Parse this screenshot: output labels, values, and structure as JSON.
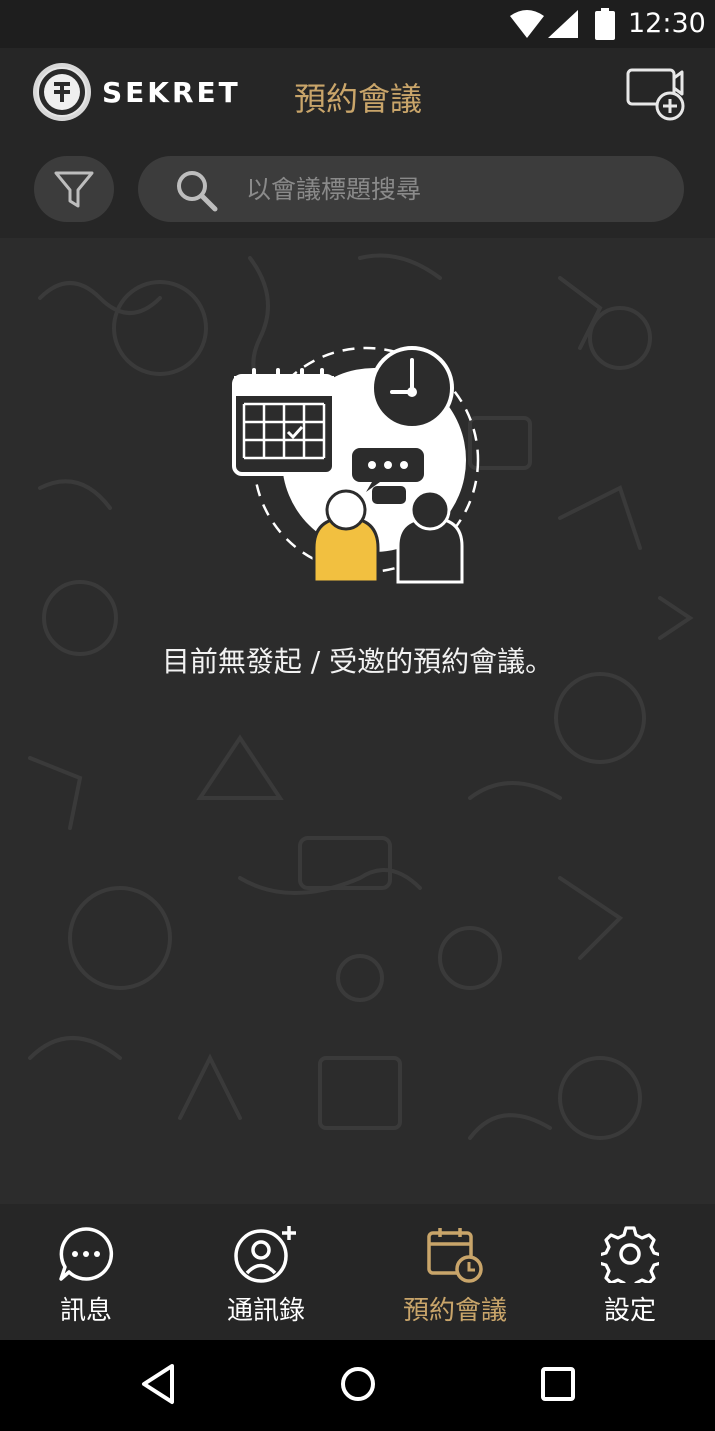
{
  "status_bar": {
    "time": "12:30"
  },
  "app_bar": {
    "brand": "SEKRET",
    "title": "預約會議",
    "accent_color": "#c9a56a"
  },
  "search": {
    "placeholder": "以會議標題搜尋"
  },
  "content": {
    "empty_message": "目前無發起 / 受邀的預約會議。"
  },
  "bottom_nav": {
    "items": [
      {
        "label": "訊息",
        "icon": "chat-bubble-icon",
        "active": false
      },
      {
        "label": "通訊錄",
        "icon": "add-contact-icon",
        "active": false
      },
      {
        "label": "預約會議",
        "icon": "calendar-clock-icon",
        "active": true
      },
      {
        "label": "設定",
        "icon": "gear-icon",
        "active": false
      }
    ]
  },
  "colors": {
    "background": "#2c2c2c",
    "bar": "#262626",
    "accent": "#c9a56a",
    "person_highlight": "#f2c040"
  }
}
